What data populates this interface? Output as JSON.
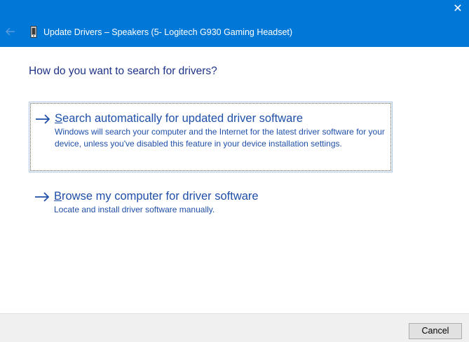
{
  "window": {
    "title": "Update Drivers – Speakers (5- Logitech G930 Gaming Headset)",
    "close_glyph": "✕",
    "accent_color": "#0078d7",
    "icons": {
      "back": "back-arrow-icon",
      "device": "device-icon",
      "close": "close-icon"
    }
  },
  "main": {
    "heading": "How do you want to search for drivers?",
    "options": [
      {
        "title": "Search automatically for updated driver software",
        "description": "Windows will search your computer and the Internet for the latest driver software for your device, unless you've disabled this feature in your device installation settings.",
        "icon": "arrow-right-icon",
        "selected": true
      },
      {
        "title": "Browse my computer for driver software",
        "description": "Locate and install driver software manually.",
        "icon": "arrow-right-icon",
        "selected": false
      }
    ]
  },
  "footer": {
    "cancel_label": "Cancel"
  }
}
